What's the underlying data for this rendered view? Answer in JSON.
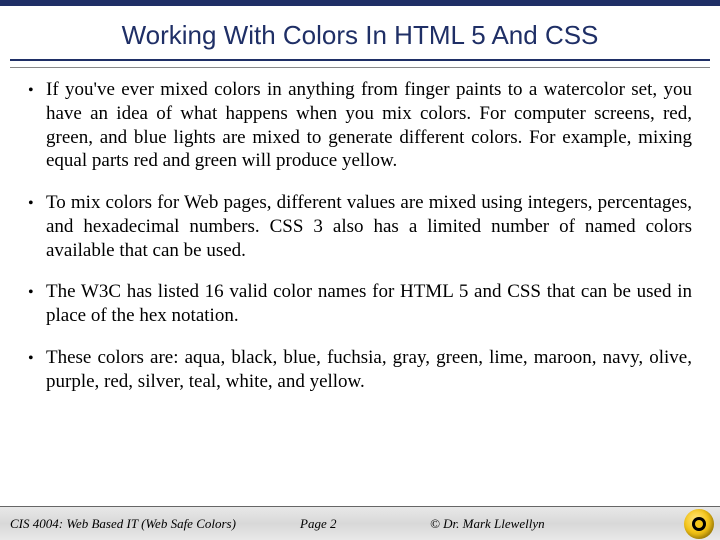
{
  "title": "Working With Colors In HTML 5 And CSS",
  "bullets": [
    "If you've ever mixed colors in anything from finger paints to a watercolor set, you have an idea of what happens when you mix colors.  For computer screens, red, green, and blue lights are mixed to generate different colors.  For example, mixing equal parts red and green will produce yellow.",
    "To mix colors for Web pages, different values are mixed using integers, percentages, and hexadecimal numbers.  CSS 3 also has a limited number of named colors available that can be used.",
    "The W3C has listed 16 valid color names for HTML 5 and CSS that can be used in place of the hex notation.",
    "These colors are: aqua, black, blue, fuchsia, gray, green, lime, maroon, navy, olive, purple, red, silver, teal, white, and yellow."
  ],
  "footer": {
    "course": "CIS 4004: Web Based IT (Web Safe Colors)",
    "page": "Page 2",
    "copyright": "© Dr. Mark Llewellyn"
  }
}
